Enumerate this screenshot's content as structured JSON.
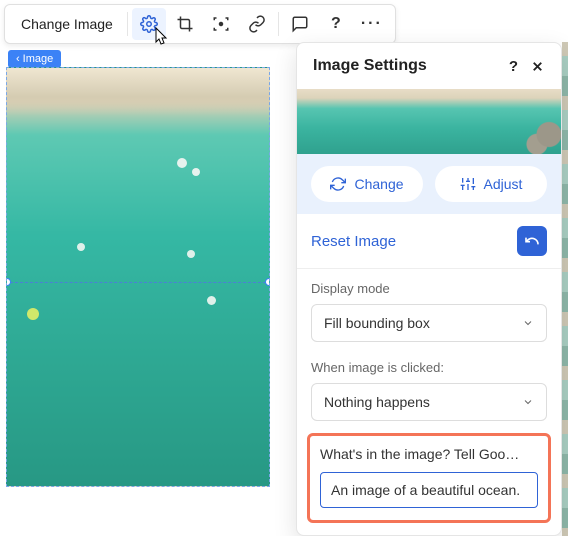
{
  "toolbar": {
    "change_label": "Change Image"
  },
  "breadcrumb": {
    "label": "Image"
  },
  "panel": {
    "title": "Image Settings",
    "change_label": "Change",
    "adjust_label": "Adjust",
    "reset_label": "Reset Image",
    "display_mode": {
      "label": "Display mode",
      "value": "Fill bounding box"
    },
    "click_action": {
      "label": "When image is clicked:",
      "value": "Nothing happens"
    },
    "alt": {
      "label": "What's in the image? Tell Goo…",
      "value": "An image of a beautiful ocean."
    }
  }
}
